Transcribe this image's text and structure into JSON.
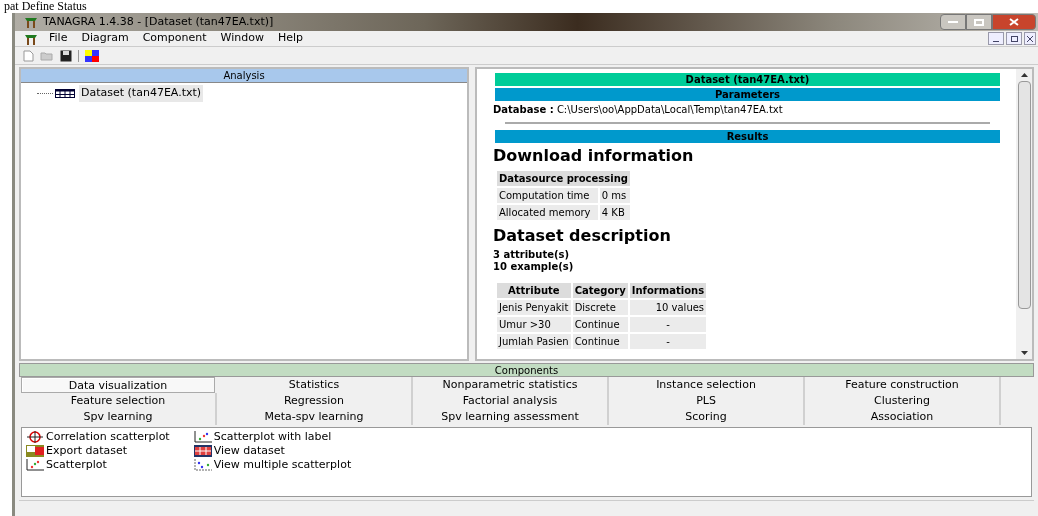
{
  "doc_caption": "pat Define Status",
  "window": {
    "title": "TANAGRA 1.4.38 - [Dataset (tan47EA.txt)]"
  },
  "menu": [
    "File",
    "Diagram",
    "Component",
    "Window",
    "Help"
  ],
  "analysis": {
    "title": "Analysis",
    "tree": [
      {
        "label": "Dataset (tan47EA.txt)",
        "selected": true
      }
    ]
  },
  "report": {
    "title": "Dataset (tan47EA.txt)",
    "parameters_header": "Parameters",
    "database": "**Database :** C:\\Users\\oo\\AppData\\Local\\Temp\\tan47EA.txt",
    "results_header": "Results",
    "download_heading": "Download information",
    "download_table": {
      "header": "Datasource processing",
      "rows": [
        [
          "Computation time",
          "0 ms"
        ],
        [
          "Allocated memory",
          "4 KB"
        ]
      ]
    },
    "dataset_heading": "Dataset description",
    "counts": [
      "3 attribute(s)",
      "10 example(s)"
    ],
    "attribute_table": {
      "columns": [
        "Attribute",
        "Category",
        "Informations"
      ],
      "rows": [
        [
          "Jenis Penyakit",
          "Discrete",
          "10 values"
        ],
        [
          "Umur >30",
          "Continue",
          "-"
        ],
        [
          "Jumlah Pasien",
          "Continue",
          "-"
        ]
      ]
    }
  },
  "components": {
    "title": "Components",
    "tabs": [
      {
        "label": "Data visualization",
        "selected": true
      },
      {
        "label": "Statistics",
        "selected": false
      },
      {
        "label": "Nonparametric statistics",
        "selected": false
      },
      {
        "label": "Instance selection",
        "selected": false
      },
      {
        "label": "Feature construction",
        "selected": false
      },
      {
        "label": "Feature selection",
        "selected": false
      },
      {
        "label": "Regression",
        "selected": false
      },
      {
        "label": "Factorial analysis",
        "selected": false
      },
      {
        "label": "PLS",
        "selected": false
      },
      {
        "label": "Clustering",
        "selected": false
      },
      {
        "label": "Spv learning",
        "selected": false
      },
      {
        "label": "Meta-spv learning",
        "selected": false
      },
      {
        "label": "Spv learning assessment",
        "selected": false
      },
      {
        "label": "Scoring",
        "selected": false
      },
      {
        "label": "Association",
        "selected": false
      }
    ],
    "items": [
      [
        "Correlation scatterplot",
        "Export dataset",
        "Scatterplot"
      ],
      [
        "Scatterplot with label",
        "View dataset",
        "View multiple scatterplot"
      ]
    ]
  }
}
